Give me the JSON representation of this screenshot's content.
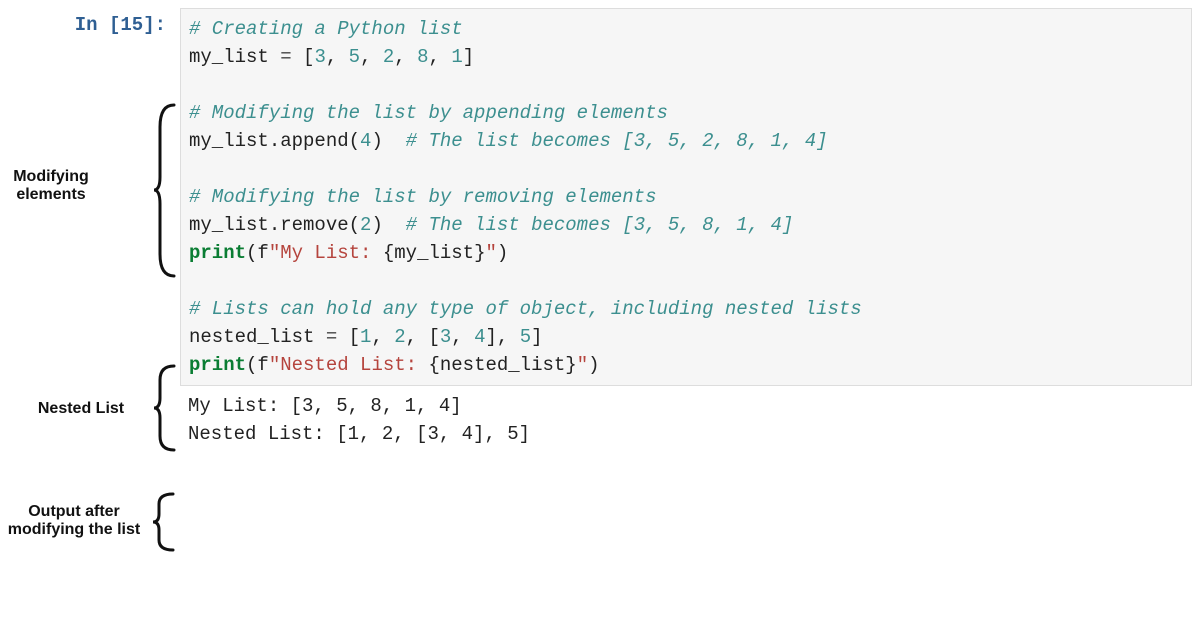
{
  "prompt": "In [15]:",
  "code": {
    "l01": {
      "c1": "# Creating a Python list"
    },
    "l02": {
      "t1": "my_list ",
      "op": "=",
      "t2": " [",
      "n1": "3",
      "c": ", ",
      "n2": "5",
      "n3": "2",
      "n4": "8",
      "n5": "1",
      "t3": "]"
    },
    "l03": "",
    "l04": {
      "c1": "# Modifying the list by appending elements"
    },
    "l05": {
      "t1": "my_list.append(",
      "n1": "4",
      "t2": ")",
      "sp": "  ",
      "c1": "# The list becomes [3, 5, 2, 8, 1, 4]"
    },
    "l06": "",
    "l07": {
      "c1": "# Modifying the list by removing elements"
    },
    "l08": {
      "t1": "my_list.remove(",
      "n1": "2",
      "t2": ")",
      "sp": "  ",
      "c1": "# The list becomes [3, 5, 8, 1, 4]"
    },
    "l09": {
      "p": "print",
      "t1": "(f",
      "s1": "\"My List: ",
      "t2": "{my_list}",
      "s2": "\"",
      "t3": ")"
    },
    "l10": "",
    "l11": {
      "c1": "# Lists can hold any type of object, including nested lists"
    },
    "l12": {
      "t1": "nested_list ",
      "op": "=",
      "t2": " [",
      "n1": "1",
      "c": ", ",
      "n2": "2",
      "t3": ", [",
      "n3": "3",
      "n4": "4",
      "t4": "], ",
      "n5": "5",
      "t5": "]"
    },
    "l13": {
      "p": "print",
      "t1": "(f",
      "s1": "\"Nested List: ",
      "t2": "{nested_list}",
      "s2": "\"",
      "t3": ")"
    }
  },
  "output": {
    "l1": "My List: [3, 5, 8, 1, 4]",
    "l2": "Nested List: [1, 2, [3, 4], 5]"
  },
  "annotations": {
    "a1": "Modifying\nelements",
    "a2": "Nested List",
    "a3": "Output after\nmodifying the list"
  }
}
